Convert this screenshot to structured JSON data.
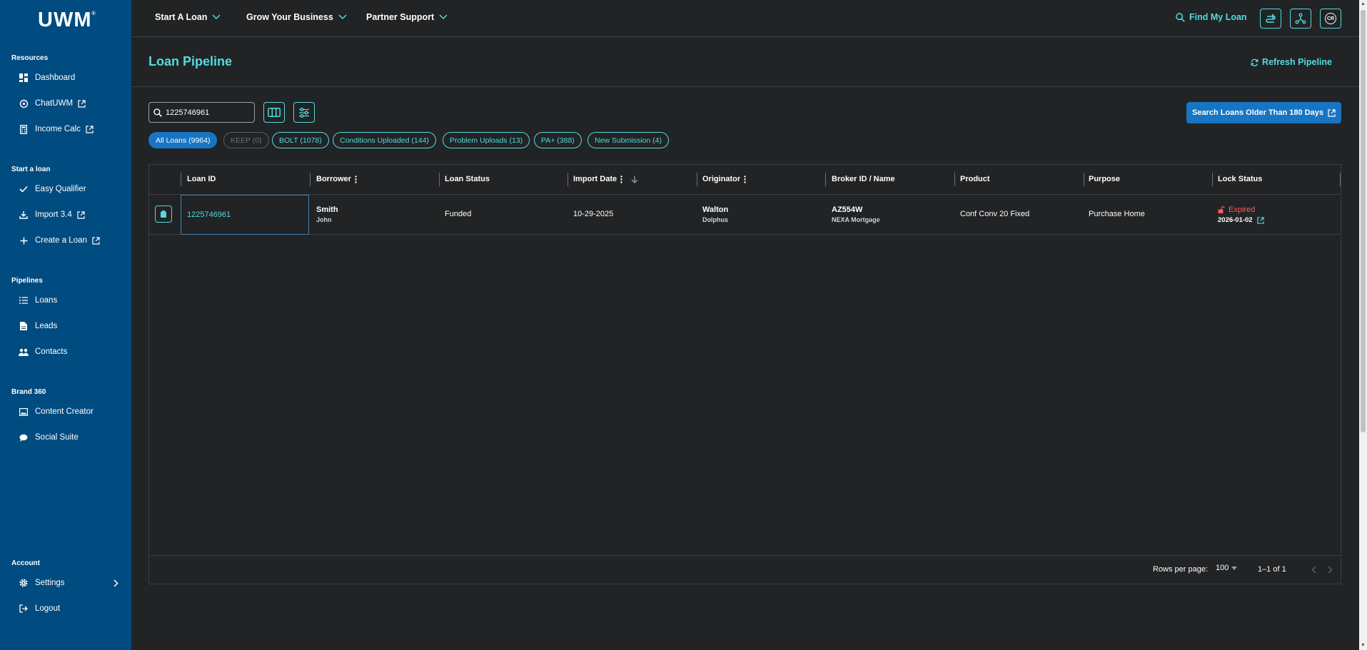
{
  "app": {
    "logo": "UWM"
  },
  "sidebar": {
    "sections": [
      {
        "title": "Resources",
        "items": [
          {
            "label": "Dashboard",
            "icon": "dashboard-icon"
          },
          {
            "label": "ChatUWM",
            "icon": "chat-icon",
            "external": true
          },
          {
            "label": "Income Calc",
            "icon": "calculator-icon",
            "external": true
          }
        ]
      },
      {
        "title": "Start a loan",
        "items": [
          {
            "label": "Easy Qualifier",
            "icon": "check-icon"
          },
          {
            "label": "Import 3.4",
            "icon": "download-icon",
            "external": true
          },
          {
            "label": "Create a Loan",
            "icon": "plus-icon",
            "external": true
          }
        ]
      },
      {
        "title": "Pipelines",
        "items": [
          {
            "label": "Loans",
            "icon": "list-icon"
          },
          {
            "label": "Leads",
            "icon": "document-icon"
          },
          {
            "label": "Contacts",
            "icon": "people-icon"
          }
        ]
      },
      {
        "title": "Brand 360",
        "items": [
          {
            "label": "Content Creator",
            "icon": "image-icon"
          },
          {
            "label": "Social Suite",
            "icon": "speech-bubble-icon"
          }
        ]
      },
      {
        "title": "Account",
        "items": [
          {
            "label": "Settings",
            "icon": "gear-icon"
          },
          {
            "label": "Logout",
            "icon": "logout-icon"
          }
        ]
      }
    ]
  },
  "topnav": {
    "items": [
      "Start A Loan",
      "Grow Your Business",
      "Partner Support"
    ],
    "find_loan": "Find My Loan",
    "avatar_initials": "CR"
  },
  "header": {
    "title": "Loan Pipeline",
    "refresh": "Refresh Pipeline"
  },
  "search": {
    "value": "1225746961"
  },
  "older_button": "Search Loans Older Than 180 Days",
  "chips": [
    "All Loans (9964)",
    "KEEP (0)",
    "BOLT (1078)",
    "Conditions Uploaded (144)",
    "Problem Uploads (13)",
    "PA+ (388)",
    "New Submission (4)"
  ],
  "table": {
    "columns": [
      "Loan ID",
      "Borrower",
      "Loan Status",
      "Import Date",
      "Originator",
      "Broker ID / Name",
      "Product",
      "Purpose",
      "Lock Status"
    ],
    "rows": [
      {
        "loan_id": "1225746961",
        "borrower_last": "Smith",
        "borrower_first": "John",
        "status": "Funded",
        "import_date": "10-29-2025",
        "originator_last": "Walton",
        "originator_first": "Dolphus",
        "broker_id": "AZ554W",
        "broker_name": "NEXA Mortgage",
        "product": "Conf Conv 20 Fixed",
        "purpose": "Purchase Home",
        "lock_status": "Expired",
        "lock_date": "2026-01-02"
      }
    ]
  },
  "footer": {
    "rows_per_page_label": "Rows per page:",
    "rows_per_page": "100",
    "range": "1–1 of 1"
  },
  "colors": {
    "accent": "#53dbe0",
    "sidebar": "#004b80",
    "primary": "#1775c4",
    "background": "#212325",
    "expired": "#ff5a5a"
  }
}
